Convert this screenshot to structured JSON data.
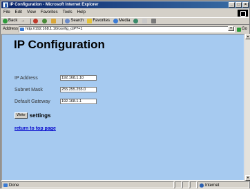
{
  "window": {
    "title": "IP Configuration - Microsoft Internet Explorer",
    "controls": {
      "minimize": "_",
      "maximize": "□",
      "close": "×"
    }
  },
  "menubar": {
    "items": [
      {
        "label": "File",
        "icon": ""
      },
      {
        "label": "Edit"
      },
      {
        "label": "View"
      },
      {
        "label": "Favorites"
      },
      {
        "label": "Tools"
      },
      {
        "label": "Help"
      }
    ]
  },
  "toolbar": {
    "back_label": "Back",
    "forward_label": "→",
    "search_label": "Search",
    "favorites_label": "Favorites",
    "media_label": "Media",
    "icons": [
      "back-icon",
      "forward-icon",
      "stop-icon",
      "refresh-icon",
      "home-icon",
      "search-icon",
      "favorites-icon",
      "media-icon",
      "history-icon",
      "mail-icon",
      "print-icon"
    ]
  },
  "addressbar": {
    "label": "Address",
    "url": "http://192.168.1.10/config_ctP?=1",
    "go_label": "Go"
  },
  "page": {
    "title": "IP Configuration",
    "fields": [
      {
        "label": "IP Address",
        "value": "192.168.1.10"
      },
      {
        "label": "Subnet Mask",
        "value": "255.255.255.0"
      },
      {
        "label": "Default Gateway",
        "value": "192.168.1.1"
      }
    ],
    "write_button": "Write",
    "write_suffix": "settings",
    "top_link": "return to top page",
    "background": "#a6caf0",
    "link_color": "#0000cc"
  },
  "statusbar": {
    "status": "Done",
    "zone": "Internet"
  }
}
